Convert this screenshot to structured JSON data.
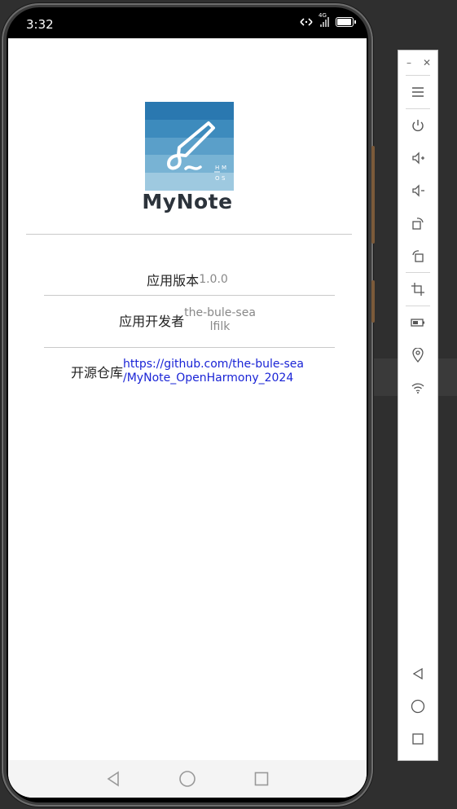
{
  "status_bar": {
    "time": "3:32",
    "network": "4G",
    "battery_level": 0.85
  },
  "app": {
    "name": "MyNote",
    "logo_badge": [
      "H",
      "M",
      "O",
      "S"
    ]
  },
  "info": {
    "version_label": "应用版本",
    "version_value": "1.0.0",
    "developer_label": "应用开发者",
    "developer_value_line1": "the-bule-sea",
    "developer_value_line2": "lfilk",
    "repo_label": "开源仓库",
    "repo_link_line1": "https://github.com/the-bule-sea",
    "repo_link_line2": "/MyNote_OpenHarmony_2024"
  },
  "colors": {
    "logo_bands": [
      "#2a78b0",
      "#3d8bbd",
      "#5a9fc9",
      "#78b3d4",
      "#9ec9e0"
    ],
    "link": "#1a24d6",
    "title": "#2c333b"
  },
  "navigation": {
    "back_icon": "triangle-back-icon",
    "home_icon": "circle-home-icon",
    "recents_icon": "square-recents-icon"
  },
  "emulator_toolbar": {
    "buttons": [
      "minimize-icon",
      "close-icon",
      "menu-icon",
      "power-icon",
      "volume-up-icon",
      "volume-down-icon",
      "rotate-icon",
      "rotate-alt-icon",
      "crop-icon",
      "battery-icon",
      "location-icon",
      "wifi-icon",
      "back-icon",
      "home-icon",
      "recents-icon"
    ]
  }
}
